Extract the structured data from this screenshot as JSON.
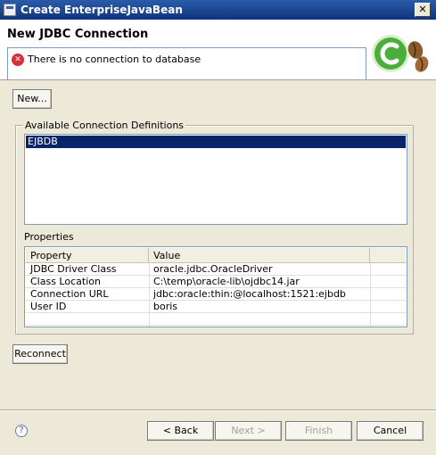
{
  "window": {
    "title": "Create EnterpriseJavaBean",
    "close_glyph": "✕",
    "icon": "window-icon"
  },
  "banner": {
    "heading": "New JDBC Connection",
    "error_message": "There is no connection to database",
    "error_icon": "error-icon",
    "logo_icon": "wizard-logo-icon"
  },
  "buttons": {
    "new": "New...",
    "reconnect": "Reconnect",
    "back": "< Back",
    "next": "Next >",
    "finish": "Finish",
    "cancel": "Cancel",
    "help_icon": "help-icon"
  },
  "connections": {
    "group_label": "Available Connection Definitions",
    "items": [
      "EJBDB"
    ],
    "selected": "EJBDB"
  },
  "properties": {
    "label": "Properties",
    "columns": [
      "Property",
      "Value"
    ],
    "rows": [
      [
        "JDBC Driver Class",
        "oracle.jdbc.OracleDriver"
      ],
      [
        "Class Location",
        "C:\\temp\\oracle-lib\\ojdbc14.jar"
      ],
      [
        "Connection URL",
        "jdbc:oracle:thin:@localhost:1521:ejbdb"
      ],
      [
        "User ID",
        "boris"
      ]
    ]
  },
  "colors": {
    "selection": "#0a246a",
    "titlebar": "#10357a",
    "error": "#d8303a",
    "logo_green": "#4cae3a"
  }
}
